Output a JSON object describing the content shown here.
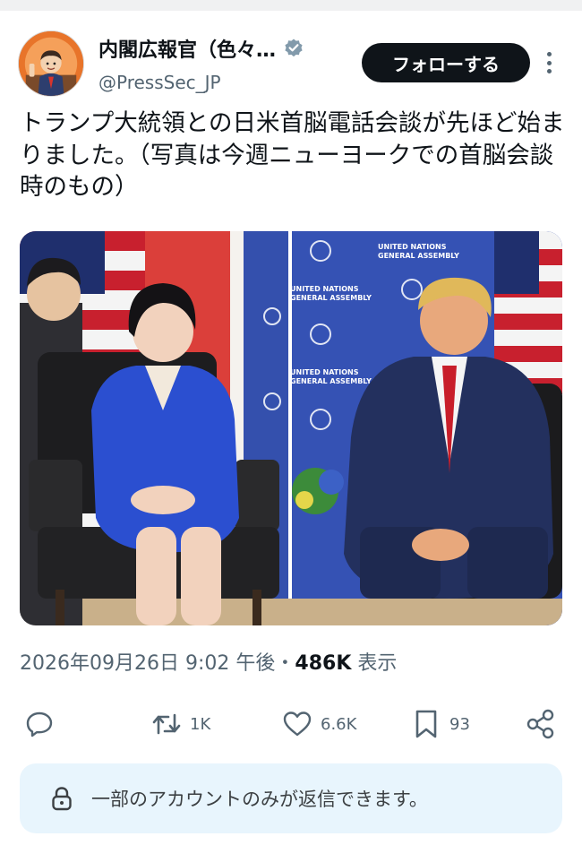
{
  "author": {
    "name": "内閣広報官（色々…",
    "handle": "@PressSec_JP",
    "verified": true,
    "follow_label": "フォローする"
  },
  "tweet": {
    "text": "トランプ大統領との日米首脳電話会談が先ほど始まりました。（写真は今週ニューヨークでの首脳会談時のもの）"
  },
  "photo": {
    "backdrop_labels": [
      "UNITED NATIONS",
      "GENERAL ASSEMBLY"
    ]
  },
  "meta": {
    "date": "2026年09月26日",
    "time": "9:02 午後",
    "separator": "・",
    "views": "486K",
    "views_label": "表示"
  },
  "actions": {
    "retweets": "1K",
    "likes": "6.6K",
    "bookmarks": "93"
  },
  "reply_restriction": "一部のアカウントのみが返信できます。",
  "colors": {
    "text": "#0f1419",
    "secondary": "#536471",
    "button": "#0f1419",
    "verified": "#829aab",
    "notice_bg": "#e8f5fd"
  }
}
